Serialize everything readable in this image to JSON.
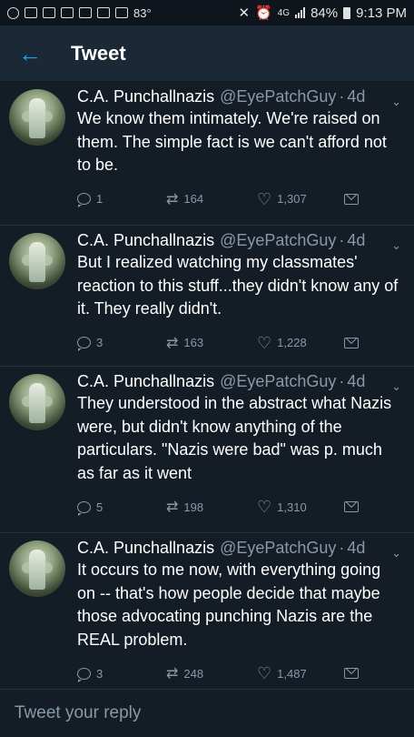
{
  "status_bar": {
    "temperature": "83°",
    "network": "4G",
    "battery": "84%",
    "time": "9:13 PM"
  },
  "header": {
    "title": "Tweet"
  },
  "tweets": [
    {
      "name": "C.A. Punchallnazis",
      "handle": "@EyePatchGuy",
      "time": "4d",
      "text": "We know them intimately. We're raised on them. The simple fact is we can't afford not to be.",
      "replies": "1",
      "retweets": "164",
      "likes": "1,307"
    },
    {
      "name": "C.A. Punchallnazis",
      "handle": "@EyePatchGuy",
      "time": "4d",
      "text": "But I realized watching my classmates' reaction to this stuff...they didn't know any of it. They really didn't.",
      "replies": "3",
      "retweets": "163",
      "likes": "1,228"
    },
    {
      "name": "C.A. Punchallnazis",
      "handle": "@EyePatchGuy",
      "time": "4d",
      "text": "They understood in the abstract what Nazis were, but didn't know anything of the particulars. \"Nazis were bad\" was p. much as far as it went",
      "replies": "5",
      "retweets": "198",
      "likes": "1,310"
    },
    {
      "name": "C.A. Punchallnazis",
      "handle": "@EyePatchGuy",
      "time": "4d",
      "text": "It occurs to me now, with everything going on -- that's how people decide that maybe those advocating punching Nazis are the REAL problem.",
      "replies": "3",
      "retweets": "248",
      "likes": "1,487"
    }
  ],
  "reply": {
    "placeholder": "Tweet your reply"
  },
  "colors": {
    "background": "#141d26",
    "accent": "#1da1f2",
    "muted": "#8899a6"
  }
}
